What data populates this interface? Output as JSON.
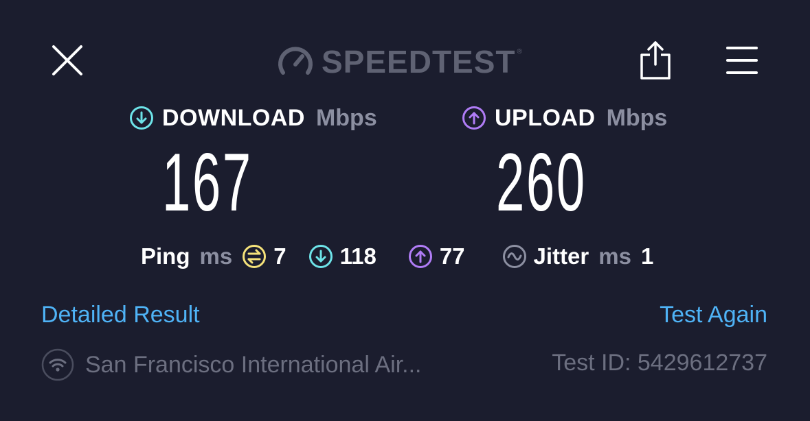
{
  "header": {
    "brand": "SPEEDTEST",
    "brand_mark": "®",
    "icons": [
      "close-icon",
      "speedometer-icon",
      "share-icon",
      "menu-icon"
    ]
  },
  "download": {
    "label": "DOWNLOAD",
    "unit": "Mbps",
    "value": "167"
  },
  "upload": {
    "label": "UPLOAD",
    "unit": "Mbps",
    "value": "260"
  },
  "ping": {
    "label": "Ping",
    "unit": "ms",
    "idle": "7",
    "download": "118",
    "upload": "77"
  },
  "jitter": {
    "label": "Jitter",
    "unit": "ms",
    "value": "1"
  },
  "links": {
    "detailed": "Detailed Result",
    "again": "Test Again"
  },
  "footer": {
    "provider": "San Francisco International Air...",
    "test_id": "Test ID: 5429612737"
  },
  "colors": {
    "background": "#1b1d2e",
    "download": "#6de3e8",
    "upload": "#b07cf6",
    "idle": "#f5e27a",
    "link": "#4fb3f6",
    "muted": "#8c8fa1"
  }
}
